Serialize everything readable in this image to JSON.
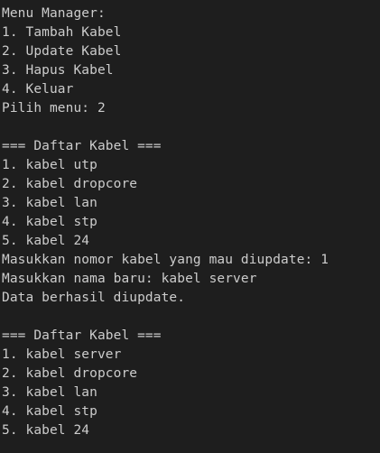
{
  "terminal": {
    "background": "#1e1e1e",
    "foreground": "#cccccc",
    "menu": {
      "title": "Menu Manager:",
      "items": [
        "1. Tambah Kabel",
        "2. Update Kabel",
        "3. Hapus Kabel",
        "4. Keluar"
      ],
      "prompt": "Pilih menu: 2"
    },
    "list_before": {
      "header": "=== Daftar Kabel ===",
      "items": [
        "1. kabel utp",
        "2. kabel dropcore",
        "3. kabel lan",
        "4. kabel stp",
        "5. kabel 24"
      ]
    },
    "update": {
      "prompt_number": "Masukkan nomor kabel yang mau diupdate: 1",
      "prompt_name": "Masukkan nama baru: kabel server",
      "result": "Data berhasil diupdate."
    },
    "list_after": {
      "header": "=== Daftar Kabel ===",
      "items": [
        "1. kabel server",
        "2. kabel dropcore",
        "3. kabel lan",
        "4. kabel stp",
        "5. kabel 24"
      ]
    }
  }
}
